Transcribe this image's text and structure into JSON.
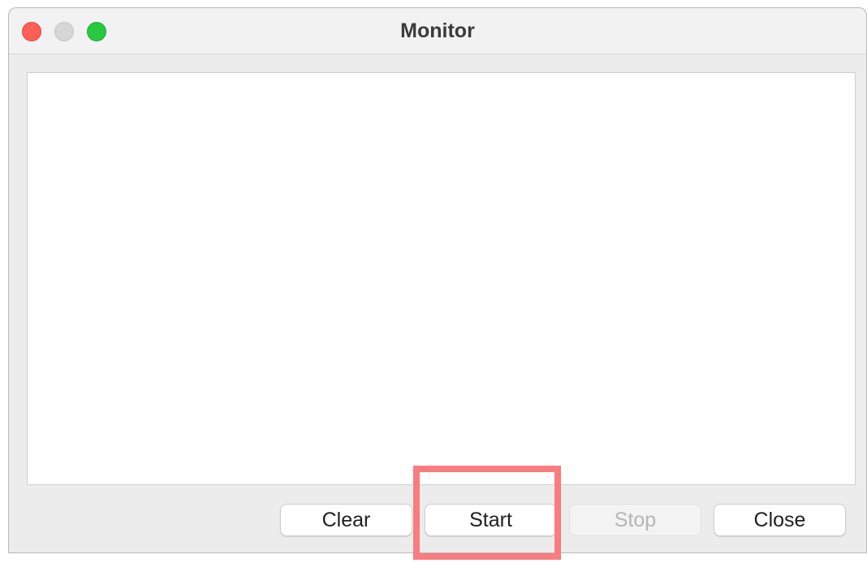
{
  "window": {
    "title": "Monitor",
    "controls": [
      "close-button",
      "minimize-button",
      "zoom-button"
    ]
  },
  "log": {
    "content": ""
  },
  "buttons": {
    "clear_label": "Clear",
    "start_label": "Start",
    "stop_label": "Stop",
    "close_label": "Close"
  },
  "states": {
    "stop_enabled": false
  },
  "colors": {
    "traffic_close": "#fe5f57",
    "traffic_minimize": "#d6d6d6",
    "traffic_zoom": "#28c840",
    "highlight": "#f87c80"
  }
}
